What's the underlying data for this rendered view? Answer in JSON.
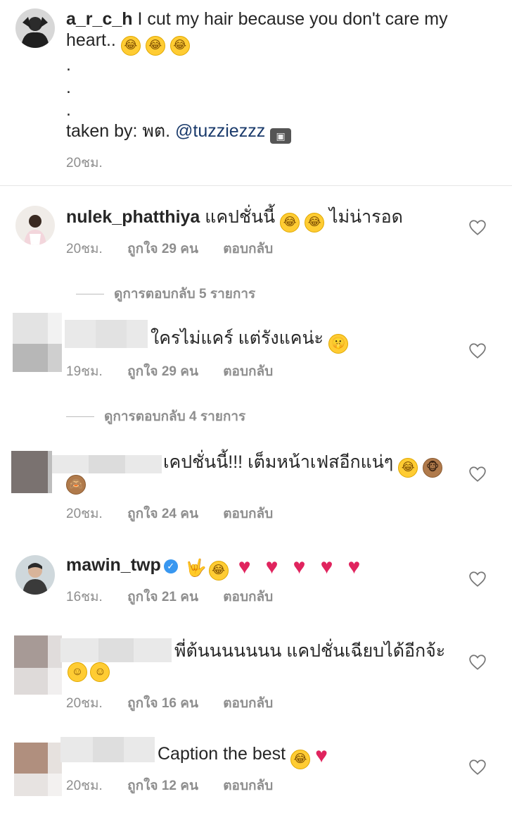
{
  "caption": {
    "username": "a_r_c_h",
    "text": "I cut my hair because you don't care my heart..",
    "dot": ".",
    "taken_by_prefix": "taken by: พต.",
    "mention": "@tuzziezzz",
    "time": "20ชม."
  },
  "comments": [
    {
      "username": "nulek_phatthiya",
      "text_a": "แคปชั่นนี้",
      "text_b": "ไม่น่ารอด",
      "time": "20ชม.",
      "likes": "ถูกใจ 29 คน",
      "reply": "ตอบกลับ",
      "view_replies": "ดูการตอบกลับ 5 รายการ"
    },
    {
      "text": "ใครไม่แคร์ แต่รังแคน่ะ",
      "time": "19ชม.",
      "likes": "ถูกใจ 29 คน",
      "reply": "ตอบกลับ",
      "view_replies": "ดูการตอบกลับ 4 รายการ"
    },
    {
      "text": "เคปชั่นนี้!!! เต็มหน้าเฟสอีกแน่ๆ",
      "time": "20ชม.",
      "likes": "ถูกใจ 24 คน",
      "reply": "ตอบกลับ"
    },
    {
      "username": "mawin_twp",
      "time": "16ชม.",
      "likes": "ถูกใจ 21 คน",
      "reply": "ตอบกลับ"
    },
    {
      "text": "พี่ต้นนนนนนน แคปชั่นเฉียบได้อีกจ้ะ",
      "time": "20ชม.",
      "likes": "ถูกใจ 16 คน",
      "reply": "ตอบกลับ"
    },
    {
      "text": "Caption the best",
      "time": "20ชม.",
      "likes": "ถูกใจ 12 คน",
      "reply": "ตอบกลับ"
    }
  ],
  "icons": {
    "heart": "heart-outline-icon",
    "verified": "verified-badge-icon",
    "rofl": "rolling-on-floor-laughing-emoji",
    "red_heart": "red-heart-emoji",
    "see_no_evil": "see-no-evil-monkey-emoji",
    "shushing": "shushing-face-emoji",
    "love_you": "love-you-gesture-emoji",
    "smile": "smiling-face-emoji",
    "joy": "face-with-tears-of-joy-emoji",
    "camera": "camera-emoji"
  },
  "colors": {
    "text": "#262626",
    "meta": "#8e8e8e",
    "mention": "#1a3a6b",
    "verified": "#3897f0",
    "heart_emoji": "#e0245e"
  }
}
